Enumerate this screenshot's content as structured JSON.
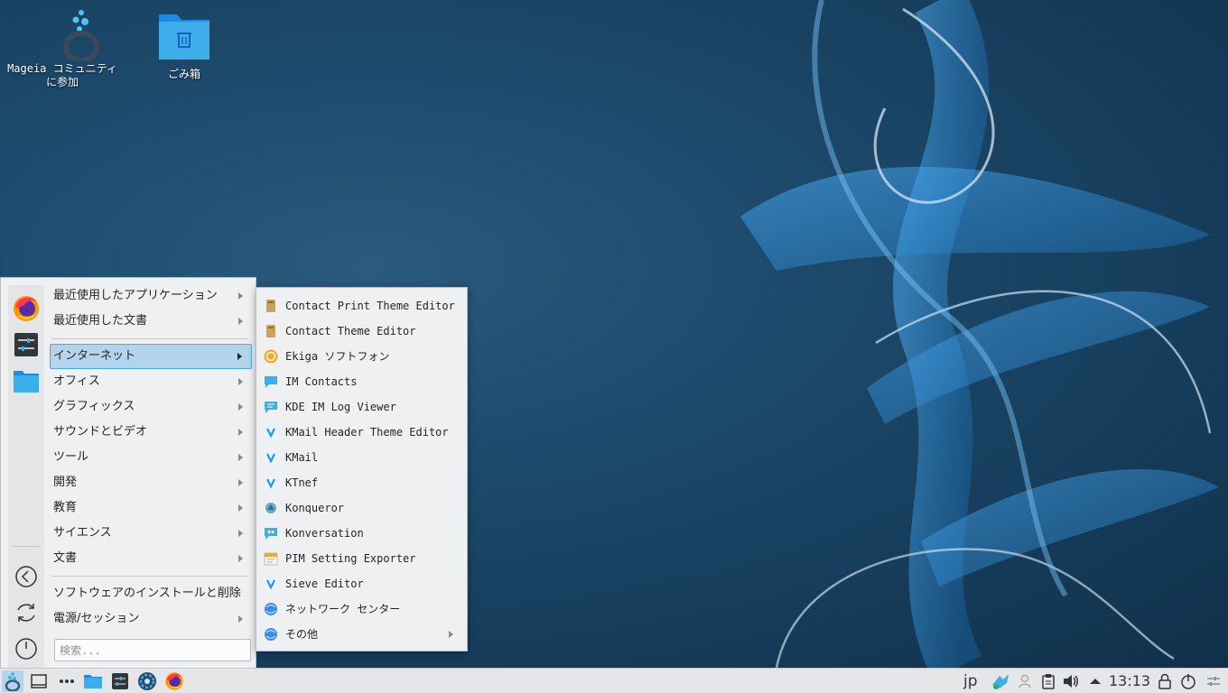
{
  "desktop": {
    "icons": [
      {
        "label_line1": "Mageia コミュニティ",
        "label_line2": "に参加",
        "icon": "mageia-community-icon"
      },
      {
        "label_line1": "ごみ箱",
        "icon": "trash-icon"
      }
    ]
  },
  "app_menu": {
    "favorites": [
      "firefox-icon",
      "settings-icon",
      "file-manager-icon"
    ],
    "sidebar_actions": [
      "back-icon",
      "refresh-icon",
      "power-icon"
    ],
    "items": [
      {
        "label": "最近使用したアプリケーション",
        "submenu": true
      },
      {
        "label": "最近使用した文書",
        "submenu": true
      },
      {
        "label": "インターネット",
        "submenu": true,
        "active": true
      },
      {
        "label": "オフィス",
        "submenu": true
      },
      {
        "label": "グラフィックス",
        "submenu": true
      },
      {
        "label": "サウンドとビデオ",
        "submenu": true
      },
      {
        "label": "ツール",
        "submenu": true
      },
      {
        "label": "開発",
        "submenu": true
      },
      {
        "label": "教育",
        "submenu": true
      },
      {
        "label": "サイエンス",
        "submenu": true
      },
      {
        "label": "文書",
        "submenu": true
      },
      {
        "label": "ソフトウェアのインストールと削除",
        "submenu": false
      },
      {
        "label": "電源/セッション",
        "submenu": true
      }
    ],
    "search_placeholder": "検索..."
  },
  "submenu": {
    "items": [
      {
        "label": "Contact Print Theme Editor",
        "icon": "theme-editor-icon"
      },
      {
        "label": "Contact Theme Editor",
        "icon": "theme-editor-icon"
      },
      {
        "label": "Ekiga ソフトフォン",
        "icon": "ekiga-icon"
      },
      {
        "label": "IM Contacts",
        "icon": "im-contacts-icon"
      },
      {
        "label": "KDE IM Log Viewer",
        "icon": "im-log-viewer-icon"
      },
      {
        "label": "KMail Header Theme Editor",
        "icon": "kmail-icon"
      },
      {
        "label": "KMail",
        "icon": "kmail-icon"
      },
      {
        "label": "KTnef",
        "icon": "ktnef-icon"
      },
      {
        "label": "Konqueror",
        "icon": "konqueror-icon"
      },
      {
        "label": "Konversation",
        "icon": "konversation-icon"
      },
      {
        "label": "PIM Setting Exporter",
        "icon": "pim-exporter-icon"
      },
      {
        "label": "Sieve Editor",
        "icon": "sieve-editor-icon"
      },
      {
        "label": "ネットワーク センター",
        "icon": "network-center-icon"
      },
      {
        "label": "その他",
        "icon": "other-icon",
        "submenu": true
      }
    ]
  },
  "taskbar": {
    "launchers": [
      "app-launcher-icon",
      "show-desktop-icon",
      "more-icon",
      "file-manager-icon",
      "system-settings-icon",
      "mageia-control-center-icon",
      "firefox-icon"
    ],
    "tray": {
      "keyboard_layout": "jp",
      "clock": "13:13"
    }
  },
  "colors": {
    "accent": "#3daee9",
    "menu_bg": "#eff0f1",
    "highlight": "#b3d4ea",
    "desktop_bg": "#1d4a6c"
  }
}
